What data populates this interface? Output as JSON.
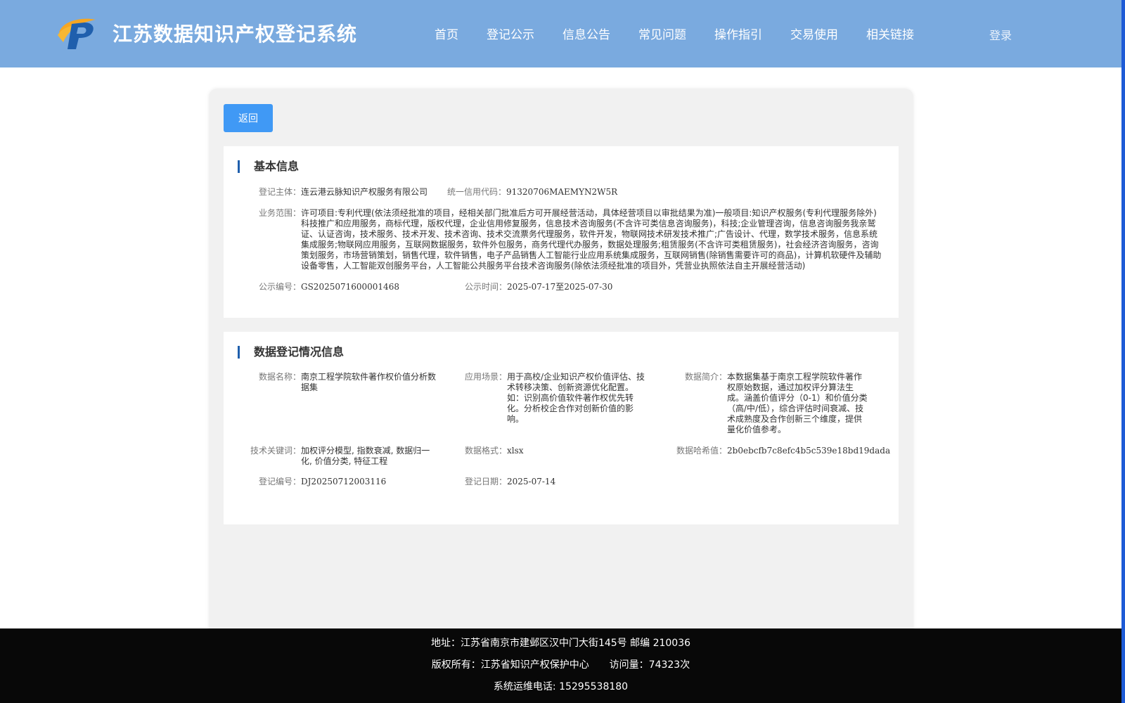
{
  "header": {
    "site_title": "江苏数据知识产权登记系统",
    "nav": [
      "首页",
      "登记公示",
      "信息公告",
      "常见问题",
      "操作指引",
      "交易使用",
      "相关链接"
    ],
    "login": "登录",
    "header_color": "#7aaadf"
  },
  "back_button": "返回",
  "basic_info": {
    "title": "基本信息",
    "subject_label": "登记主体：",
    "subject_value": "连云港云脉知识产权服务有限公司",
    "credit_label": "统一信用代码：",
    "credit_value": "91320706MAEMYN2W5R",
    "scope_label": "业务范围：",
    "scope_value": "许可项目:专利代理(依法须经批准的项目，经相关部门批准后方可开展经营活动，具体经营项目以审批结果为准)一般项目:知识产权服务(专利代理服务除外)科技推广和应用服务，商标代理，版权代理，企业信用修复服务，信息技术咨询服务(不含许可类信息咨询服务)，科技;企业管理咨询，信息咨询服务我亲鹫证、认证咨询，技术服务、技术开发、技术咨询、技术交流票务代理服务，软件开发，物联网技术研发技术推广;广告设计、代理，数学技术服务，信息系统集成服务;物联网应用服务，互联网数据服务，软件外包服务，商务代理代办服务，数据处理服务;租赁服务(不含许可类租赁服务)，社会经济咨询服务，咨询策划服务，市场营销策划，销售代理，软件销售，电子产品销售人工智能行业应用系统集成服务，互联网销售(除销售需要许可的商品)，计算机软硬件及辅助设备零售，人工智能双创服务平台，人工智能公共服务平台技术咨询服务(除依法须经批准的项目外，凭营业执照依法自主开展经营活动)",
    "notice_no_label": "公示编号：",
    "notice_no_value": "GS2025071600001468",
    "notice_time_label": "公示时间：",
    "notice_time_from": "2025-07-17",
    "notice_time_sep": "至",
    "notice_time_to": "2025-07-30"
  },
  "data_info": {
    "title": "数据登记情况信息",
    "name_label": "数据名称：",
    "name_value": "南京工程学院软件著作权价值分析数据集",
    "scene_label": "应用场景：",
    "scene_value": "用于高校/企业知识产权价值评估、技术转移决策、创新资源优化配置。如：识别高价值软件著作权优先转化。分析校企合作对创新价值的影响。",
    "intro_label": "数据简介：",
    "intro_value": "本数据集基于南京工程学院软件著作权原始数据，通过加权评分算法生成。涵盖价值评分（0-1）和价值分类（高/中/低），综合评估时间衰减、技术成熟度及合作创新三个维度，提供量化价值参考。",
    "keywords_label": "技术关键词：",
    "keywords_value": "加权评分模型, 指数衰减, 数据归一化, 价值分类, 特征工程",
    "format_label": "数据格式：",
    "format_value": "xlsx",
    "hash_label": "数据哈希值：",
    "hash_value": "2b0ebcfb7c8efc4b5c539e18bd19dada",
    "reg_no_label": "登记编号：",
    "reg_no_value": "DJ20250712003116",
    "reg_date_label": "登记日期：",
    "reg_date_value": "2025-07-14"
  },
  "footer": {
    "address": "地址：江苏省南京市建邺区汉中门大街145号 邮编 210036",
    "copyright": "版权所有：江苏省知识产权保护中心",
    "visits": "访问量：74323次",
    "hotline": "系统运维电话: 15295538180"
  }
}
